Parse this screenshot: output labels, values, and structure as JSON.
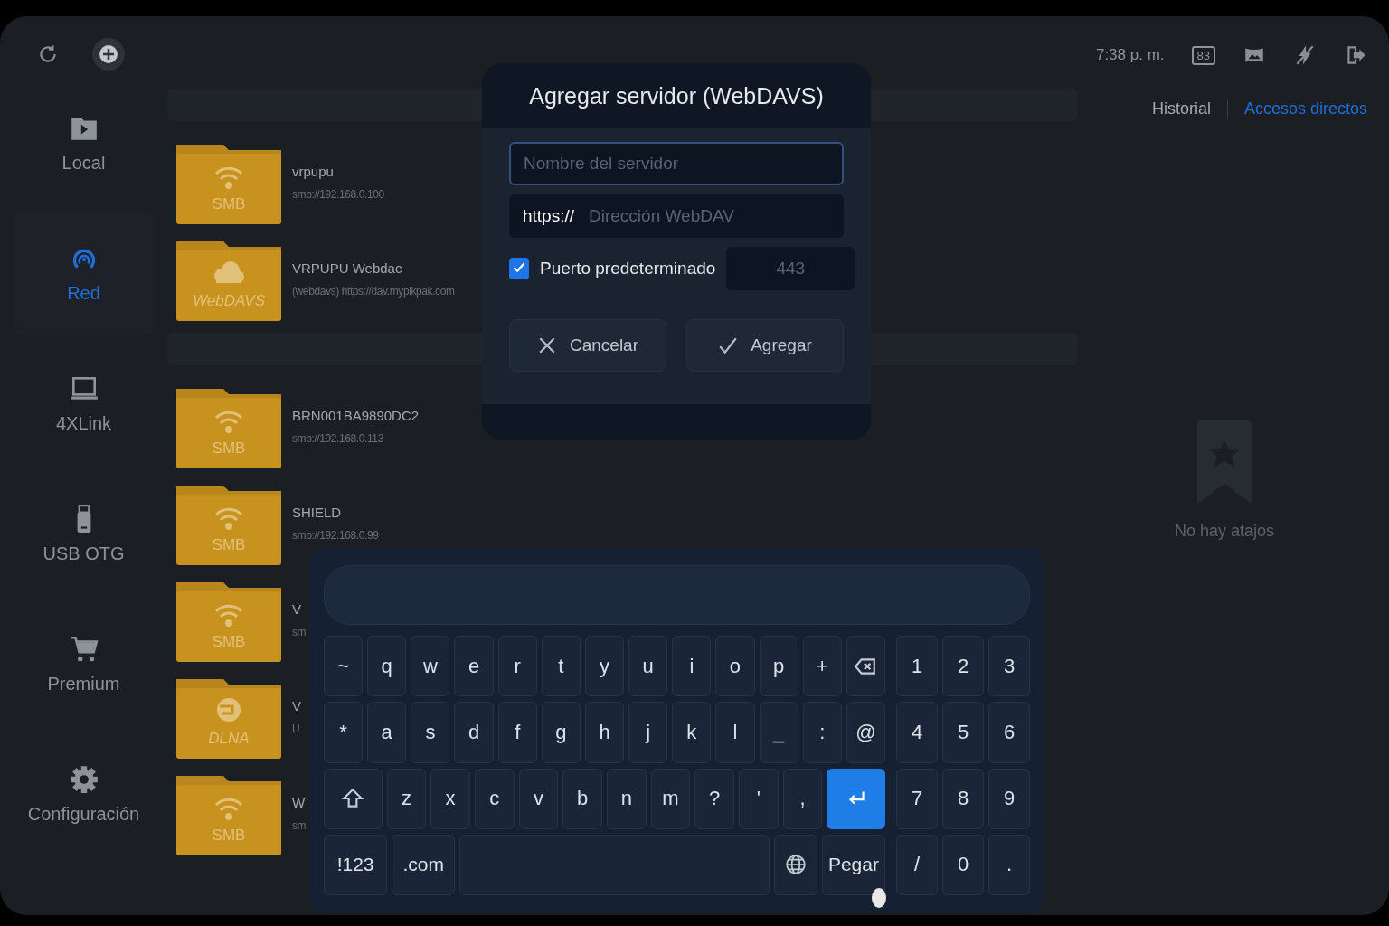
{
  "toolbar": {
    "buttons": [
      {
        "kind": "refresh"
      },
      {
        "kind": "add"
      }
    ]
  },
  "sidebar": [
    {
      "kind": "local",
      "label": "Local",
      "selected": false
    },
    {
      "kind": "network",
      "label": "Red",
      "selected": true
    },
    {
      "kind": "laptop",
      "label": "4XLink",
      "selected": false
    },
    {
      "kind": "usb",
      "label": "USB OTG",
      "selected": false
    },
    {
      "kind": "cart",
      "label": "Premium",
      "selected": false
    },
    {
      "kind": "gear",
      "label": "Configuración",
      "selected": false
    }
  ],
  "sections": [
    {
      "servers": [
        {
          "kind": "smb",
          "type_label": "SMB",
          "name": "vrpupu",
          "address": "smb://192.168.0.100"
        },
        {
          "kind": "webdav",
          "type_label": "WebDAVS",
          "name": "VRPUPU Webdac",
          "address": "(webdavs) https://dav.mypikpak.com"
        }
      ]
    },
    {
      "servers": [
        {
          "kind": "smb",
          "type_label": "SMB",
          "name": "BRN001BA9890DC2",
          "address": "smb://192.168.0.113"
        },
        {
          "kind": "smb",
          "type_label": "SMB",
          "name": "SHIELD",
          "address": "smb://192.168.0.99"
        },
        {
          "kind": "smb",
          "type_label": "SMB",
          "name": "V",
          "address": "sm"
        },
        {
          "kind": "dlna",
          "type_label": "DLNA",
          "name": "V",
          "address": "U"
        },
        {
          "kind": "smb",
          "type_label": "SMB",
          "name": "W",
          "address": "sm"
        }
      ]
    }
  ],
  "status": {
    "time": "7:38 p. m.",
    "battery": "83",
    "icons": [
      {
        "kind": "panorama"
      },
      {
        "kind": "no-flash"
      },
      {
        "kind": "exit"
      }
    ]
  },
  "tabs": [
    {
      "label": "Historial",
      "selected": false
    },
    {
      "label": "Accesos directos",
      "selected": true
    }
  ],
  "empty_state": {
    "message": "No hay atajos"
  },
  "dialog": {
    "title": "Agregar servidor (WebDAVS)",
    "name_field": {
      "placeholder": "Nombre del servidor"
    },
    "url_field": {
      "prefix": "https://",
      "placeholder": "Dirección WebDAV"
    },
    "default_port": {
      "label": "Puerto predeterminado",
      "checked": true
    },
    "port_field": {
      "placeholder": "443"
    },
    "buttons": [
      {
        "kind": "cancel",
        "label": "Cancelar"
      },
      {
        "kind": "confirm",
        "label": "Agregar"
      }
    ]
  },
  "keyboard": {
    "rows": [
      {
        "keys": [
          {
            "kind": "char",
            "label": "~"
          },
          {
            "kind": "char",
            "label": "q"
          },
          {
            "kind": "char",
            "label": "w"
          },
          {
            "kind": "char",
            "label": "e"
          },
          {
            "kind": "char",
            "label": "r"
          },
          {
            "kind": "char",
            "label": "t"
          },
          {
            "kind": "char",
            "label": "y"
          },
          {
            "kind": "char",
            "label": "u"
          },
          {
            "kind": "char",
            "label": "i"
          },
          {
            "kind": "char",
            "label": "o"
          },
          {
            "kind": "char",
            "label": "p"
          },
          {
            "kind": "char",
            "label": "+"
          },
          {
            "kind": "backspace"
          }
        ]
      },
      {
        "keys": [
          {
            "kind": "char",
            "label": "*"
          },
          {
            "kind": "char",
            "label": "a"
          },
          {
            "kind": "char",
            "label": "s"
          },
          {
            "kind": "char",
            "label": "d"
          },
          {
            "kind": "char",
            "label": "f"
          },
          {
            "kind": "char",
            "label": "g"
          },
          {
            "kind": "char",
            "label": "h"
          },
          {
            "kind": "char",
            "label": "j"
          },
          {
            "kind": "char",
            "label": "k"
          },
          {
            "kind": "char",
            "label": "l"
          },
          {
            "kind": "char",
            "label": "_"
          },
          {
            "kind": "char",
            "label": ":"
          },
          {
            "kind": "char",
            "label": "@"
          }
        ]
      },
      {
        "keys": [
          {
            "kind": "shift"
          },
          {
            "kind": "char",
            "label": "z"
          },
          {
            "kind": "char",
            "label": "x"
          },
          {
            "kind": "char",
            "label": "c"
          },
          {
            "kind": "char",
            "label": "v"
          },
          {
            "kind": "char",
            "label": "b"
          },
          {
            "kind": "char",
            "label": "n"
          },
          {
            "kind": "char",
            "label": "m"
          },
          {
            "kind": "char",
            "label": "?"
          },
          {
            "kind": "char",
            "label": "'"
          },
          {
            "kind": "char",
            "label": ","
          },
          {
            "kind": "enter"
          }
        ]
      },
      {
        "keys": [
          {
            "kind": "wide",
            "label": "!123"
          },
          {
            "kind": "wide",
            "label": ".com"
          },
          {
            "kind": "space"
          },
          {
            "kind": "globe"
          },
          {
            "kind": "wide",
            "label": "Pegar"
          }
        ]
      }
    ],
    "numpad": [
      [
        "1",
        "2",
        "3"
      ],
      [
        "4",
        "5",
        "6"
      ],
      [
        "7",
        "8",
        "9"
      ],
      [
        "/",
        "0",
        "."
      ]
    ]
  }
}
